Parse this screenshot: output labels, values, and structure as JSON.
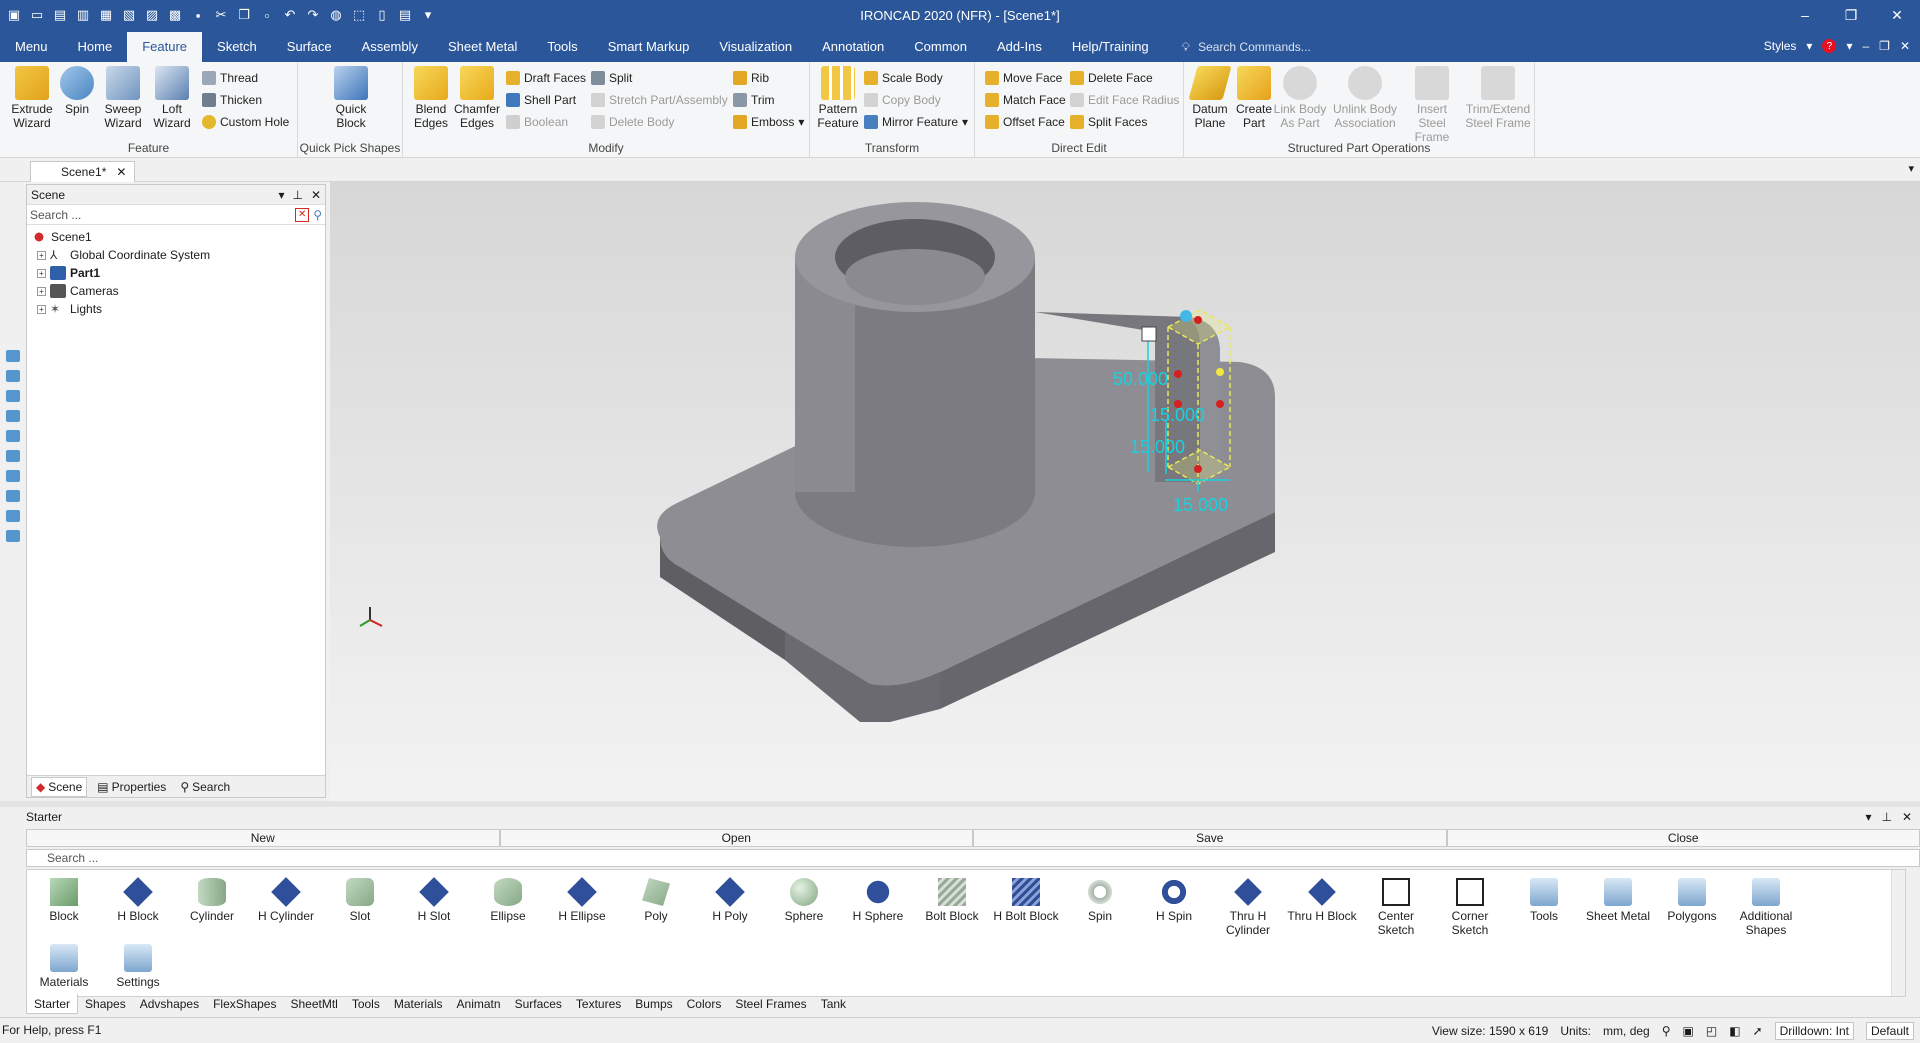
{
  "app": {
    "title": "IRONCAD 2020 (NFR) - [Scene1*]"
  },
  "menubar": {
    "tabs": [
      "Menu",
      "Home",
      "Feature",
      "Sketch",
      "Surface",
      "Assembly",
      "Sheet Metal",
      "Tools",
      "Smart Markup",
      "Visualization",
      "Annotation",
      "Common",
      "Add-Ins",
      "Help/Training"
    ],
    "active_tab": "Feature",
    "search_placeholder": "Search Commands...",
    "styles_label": "Styles"
  },
  "ribbon": {
    "feature_group": {
      "label": "Feature",
      "big": [
        "Extrude Wizard",
        "Spin",
        "Sweep Wizard",
        "Loft Wizard"
      ],
      "small": [
        "Thread",
        "Thicken",
        "Custom Hole"
      ]
    },
    "quickpick_group": {
      "label": "Quick Pick Shapes",
      "big": [
        "Quick Block"
      ]
    },
    "modify_group": {
      "label": "Modify",
      "big": [
        "Blend Edges",
        "Chamfer Edges"
      ],
      "small_col1": [
        "Draft Faces",
        "Shell Part",
        "Boolean"
      ],
      "small_col2": [
        "Split",
        "Stretch Part/Assembly",
        "Delete Body"
      ],
      "small_col3": [
        "Rib",
        "Trim",
        "Emboss"
      ]
    },
    "transform_group": {
      "label": "Transform",
      "big": [
        "Pattern Feature"
      ],
      "small": [
        "Scale Body",
        "Copy Body",
        "Mirror Feature"
      ]
    },
    "directedit_group": {
      "label": "Direct Edit",
      "small_col1": [
        "Move Face",
        "Match Face",
        "Offset Face"
      ],
      "small_col2": [
        "Delete Face",
        "Edit Face Radius",
        "Split Faces"
      ]
    },
    "structured_group": {
      "label": "Structured Part Operations",
      "big": [
        "Datum Plane",
        "Create Part",
        "Link Body As Part",
        "Unlink Body Association",
        "Insert Steel Frame",
        "Trim/Extend Steel Frame"
      ]
    }
  },
  "doc_tab": {
    "label": "Scene1*"
  },
  "scene_panel": {
    "title": "Scene",
    "search_placeholder": "Search ...",
    "tree": [
      "Scene1",
      "Global Coordinate System",
      "Part1",
      "Cameras",
      "Lights"
    ],
    "footer_tabs": [
      "Scene",
      "Properties",
      "Search"
    ]
  },
  "viewport": {
    "dimensions": [
      "50.000",
      "15.000",
      "15.000",
      "15.000"
    ]
  },
  "starter": {
    "title": "Starter",
    "actions": [
      "New",
      "Open",
      "Save",
      "Close"
    ],
    "search_placeholder": "Search ...",
    "items": [
      "Block",
      "H Block",
      "Cylinder",
      "H Cylinder",
      "Slot",
      "H Slot",
      "Ellipse",
      "H Ellipse",
      "Poly",
      "H Poly",
      "Sphere",
      "H Sphere",
      "Bolt Block",
      "H Bolt Block",
      "Spin",
      "H Spin",
      "Thru H Cylinder",
      "Thru H Block",
      "Center Sketch",
      "Corner Sketch",
      "Tools",
      "Sheet Metal",
      "Polygons",
      "Additional Shapes",
      "Materials",
      "Settings"
    ],
    "tabs": [
      "Starter",
      "Shapes",
      "Advshapes",
      "FlexShapes",
      "SheetMtl",
      "Tools",
      "Materials",
      "Animatn",
      "Surfaces",
      "Textures",
      "Bumps",
      "Colors",
      "Steel Frames",
      "Tank"
    ]
  },
  "status": {
    "help": "For Help, press F1",
    "view_size": "View size: 1590 x 619",
    "units_label": "Units:",
    "units_value": "mm, deg",
    "drilldown": "Drilldown: Int",
    "default": "Default"
  },
  "colors": {
    "titlebar": "#2b579a",
    "dimension": "#16d2e0",
    "part": "#7a7a80"
  }
}
